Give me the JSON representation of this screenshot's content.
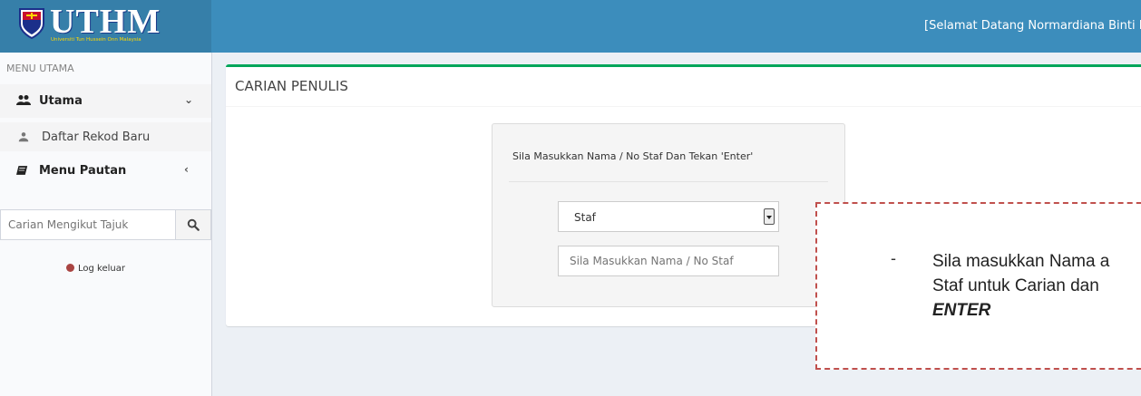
{
  "header": {
    "logo_text": "UTHM",
    "logo_subtitle": "Universiti Tun Hussein Onn Malaysia",
    "welcome": "[Selamat Datang Normardiana Binti Marc"
  },
  "sidebar": {
    "menu_header": "MENU UTAMA",
    "items": [
      {
        "label": "Utama",
        "icon": "users-icon",
        "arrow": "chevron-down-icon"
      },
      {
        "label": "Daftar Rekod Baru",
        "icon": "user-icon"
      },
      {
        "label": "Menu Pautan",
        "icon": "book-icon",
        "arrow": "chevron-left-icon"
      }
    ],
    "search_placeholder": "Carian Mengikut Tajuk",
    "logout": "Log keluar"
  },
  "main": {
    "title": "CARIAN PENULIS",
    "instruction": "Sila Masukkan Nama / No Staf Dan Tekan 'Enter'",
    "select_value": "Staf",
    "input_placeholder": "Sila Masukkan Nama / No Staf"
  },
  "callout": {
    "bullet": "-",
    "line1": "Sila masukkan Nama a",
    "line2": "Staf untuk Carian dan",
    "line3": "ENTER"
  },
  "colors": {
    "header": "#3c8dbc",
    "logo_bg": "#367fa9",
    "box_accent": "#00a65a",
    "callout_border": "#c0504d"
  }
}
